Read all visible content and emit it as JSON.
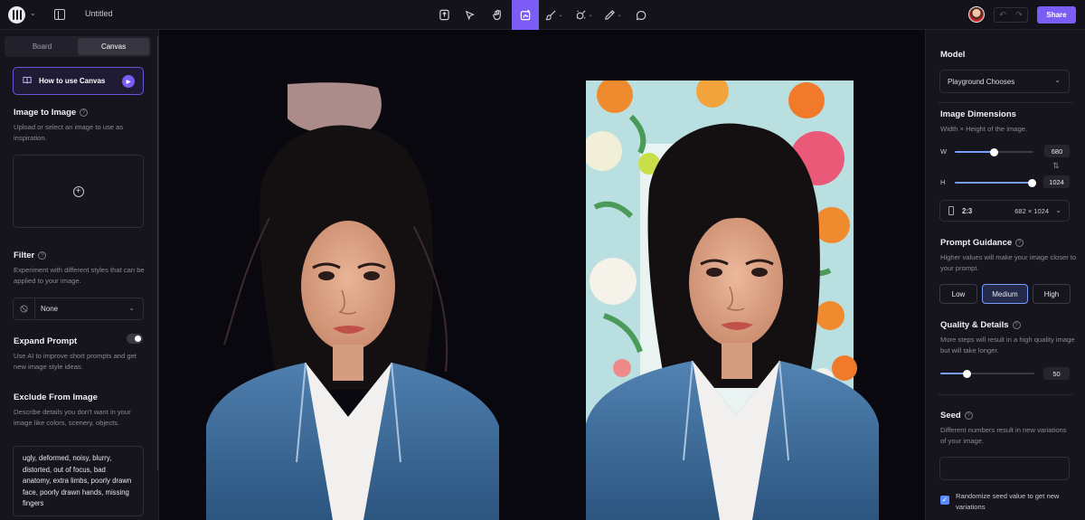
{
  "app": {
    "doc_title": "Untitled",
    "share_label": "Share",
    "undo_icon": "↶",
    "redo_icon": "↷"
  },
  "toolbar": {
    "tools": [
      "upload-icon",
      "select-icon",
      "hand-icon",
      "generate-icon",
      "brush-icon",
      "eraser-icon",
      "pen-icon",
      "comment-icon"
    ],
    "active_tool": "generate-icon",
    "dropdown_glyph": "⌄"
  },
  "left_panel": {
    "tabs": [
      "Board",
      "Canvas"
    ],
    "active_tab": "Canvas",
    "howto_label": "How to use Canvas",
    "image_to_image": {
      "title": "Image to Image",
      "desc": "Upload or select an image to use as inspiration.",
      "plus": "+"
    },
    "filter": {
      "title": "Filter",
      "desc": "Experiment with different styles that can be applied to your image.",
      "value": "None"
    },
    "expand_prompt": {
      "title": "Expand Prompt",
      "desc": "Use AI to improve short prompts and get new image style ideas.",
      "enabled": true
    },
    "exclude": {
      "title": "Exclude From Image",
      "desc": "Describe details you don't want in your image like colors, scenery, objects.",
      "value": "ugly, deformed, noisy, blurry, distorted, out of focus, bad anatomy, extra limbs, poorly drawn face, poorly drawn hands, missing fingers"
    }
  },
  "right_panel": {
    "model": {
      "title": "Model",
      "value": "Playground Chooses"
    },
    "dimensions": {
      "title": "Image Dimensions",
      "desc": "Width × Height of the image.",
      "w_label": "W",
      "w_value": "680",
      "w_fraction": 0.5,
      "h_label": "H",
      "h_value": "1024",
      "h_fraction": 0.98,
      "swap": "⇅",
      "ratio": "2:3",
      "ratio_size": "682 × 1024"
    },
    "guidance": {
      "title": "Prompt Guidance",
      "desc": "Higher values will make your image closer to your prompt.",
      "options": [
        "Low",
        "Medium",
        "High"
      ],
      "selected": "Medium"
    },
    "quality": {
      "title": "Quality & Details",
      "desc": "More steps will result in a high quality image but will take longer.",
      "value": "50",
      "fraction": 0.28
    },
    "seed": {
      "title": "Seed",
      "desc": "Different numbers result in new variations of your image.",
      "value": "",
      "randomize_label": "Randomize seed value to get new variations",
      "randomize_checked": true
    }
  }
}
